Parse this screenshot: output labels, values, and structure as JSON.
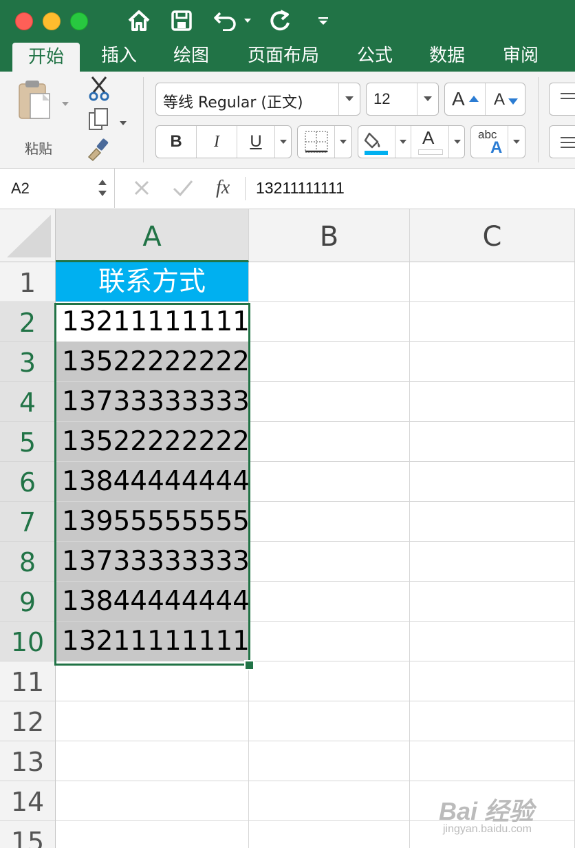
{
  "app": {
    "accent_color": "#217346",
    "header_fill_color": "#00B0F0",
    "selection_fill_color": "#C8C8C8"
  },
  "quick_access": {
    "icons": [
      "home-icon",
      "save-icon",
      "undo-icon",
      "redo-icon",
      "customize-toolbar-icon"
    ]
  },
  "tabs": [
    "开始",
    "插入",
    "绘图",
    "页面布局",
    "公式",
    "数据",
    "审阅"
  ],
  "ribbon": {
    "paste_label": "粘贴",
    "font_name": "等线 Regular (正文)",
    "font_size": "12",
    "increase_font_label": "A",
    "decrease_font_label": "A",
    "bold_label": "B",
    "italic_label": "I",
    "underline_label": "U",
    "font_color_label": "A",
    "phonetic_label_top": "abc",
    "phonetic_label_bottom": "A"
  },
  "formula_bar": {
    "name_box": "A2",
    "fx_label": "fx",
    "content": "13211111111"
  },
  "sheet": {
    "columns": [
      "A",
      "B",
      "C"
    ],
    "rows": [
      "1",
      "2",
      "3",
      "4",
      "5",
      "6",
      "7",
      "8",
      "9",
      "10",
      "11",
      "12",
      "13",
      "14",
      "15"
    ],
    "header_cell": "联系方式",
    "values": [
      "13211111111",
      "13522222222",
      "13733333333",
      "13522222222",
      "13844444444",
      "13955555555",
      "13733333333",
      "13844444444",
      "13211111111"
    ],
    "selected_range": "A2:A10",
    "active_cell": "A2"
  },
  "watermark": {
    "text": "Bai 经验",
    "url_text": "jingyan.baidu.com"
  }
}
